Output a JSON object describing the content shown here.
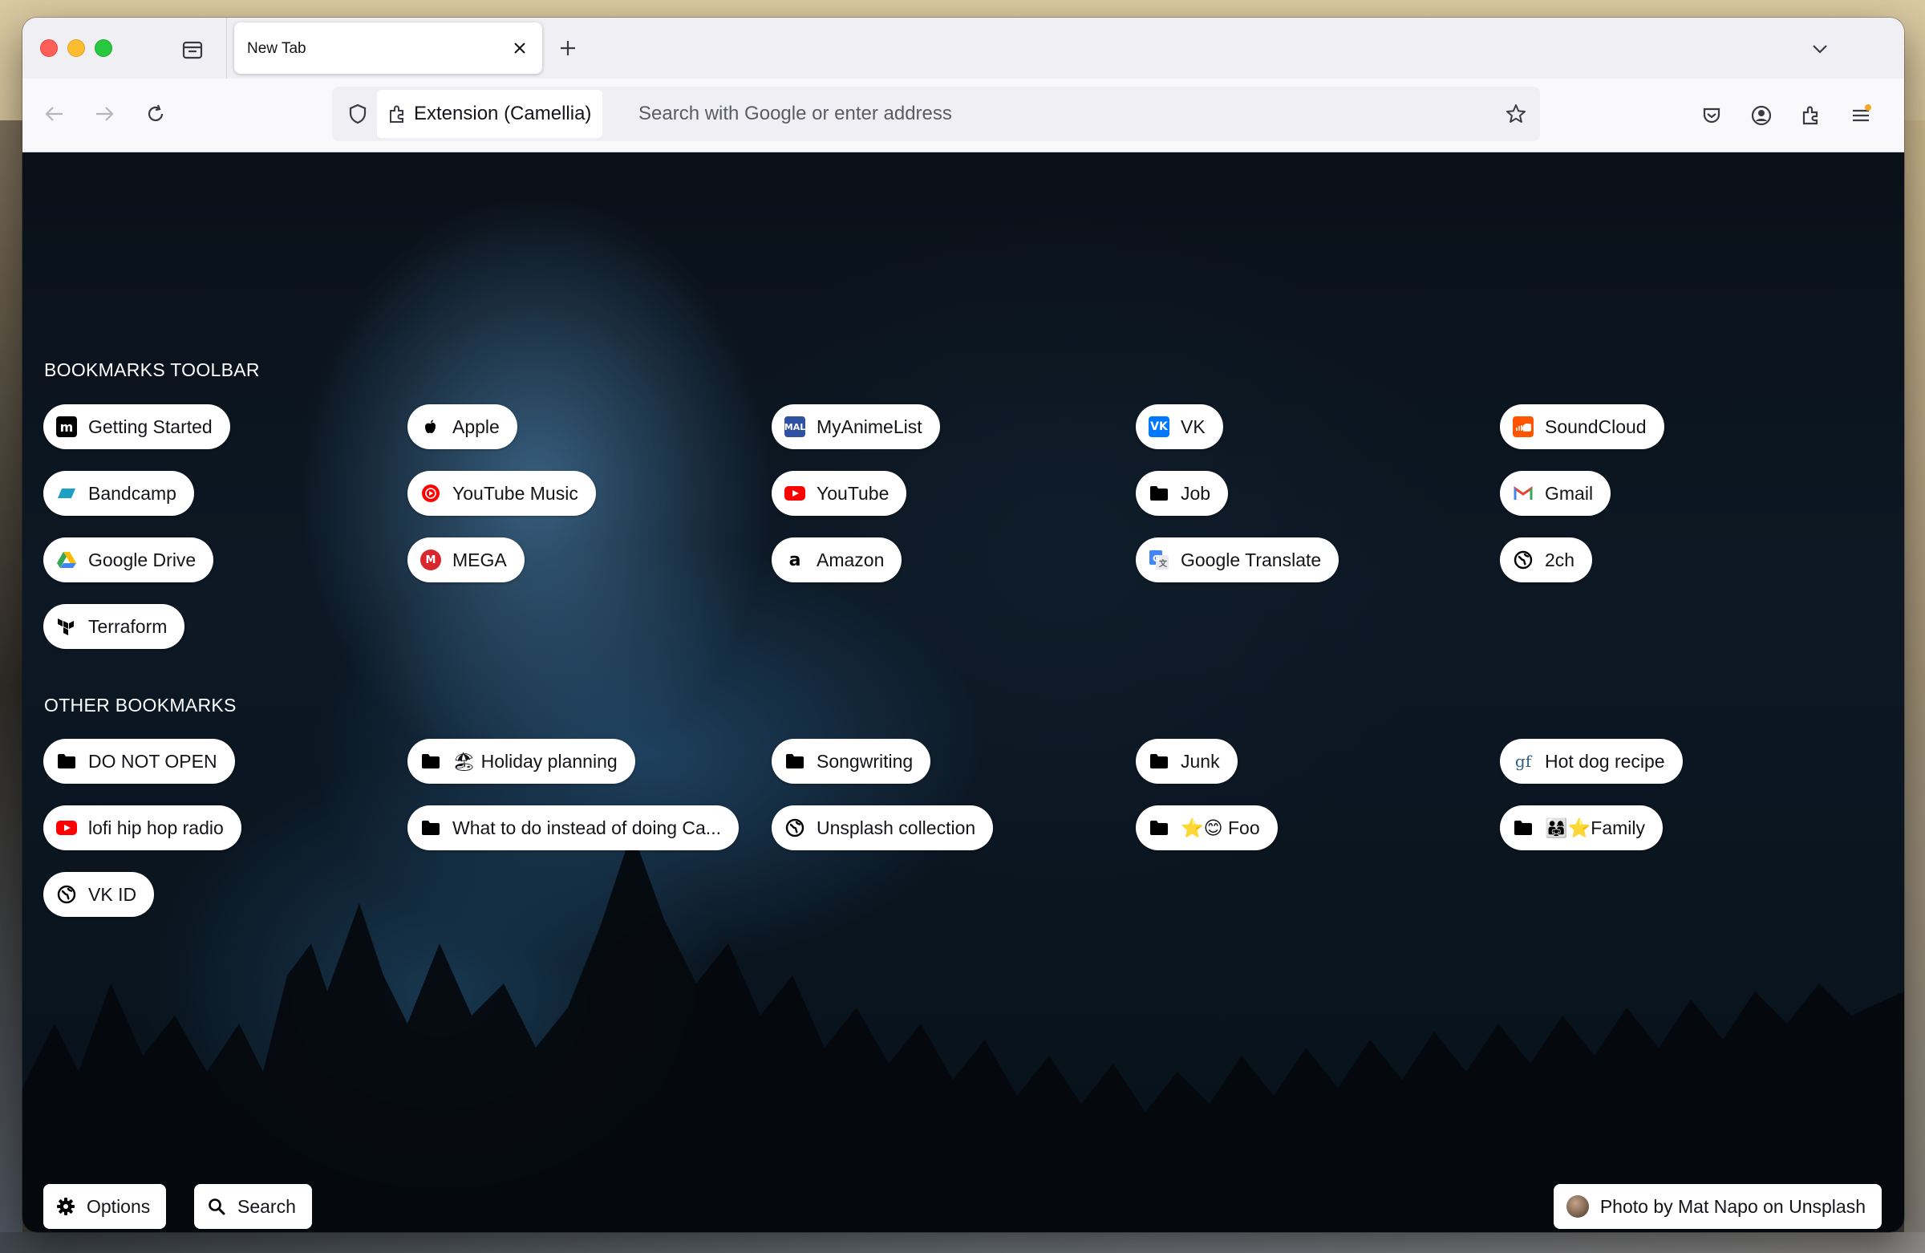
{
  "browser": {
    "tab_title": "New Tab",
    "extension_label": "Extension (Camellia)",
    "address_placeholder": "Search with Google or enter address"
  },
  "toolbar_section": {
    "title": "BOOKMARKS TOOLBAR",
    "items": [
      {
        "label": "Getting Started",
        "icon": "mozilla-icon"
      },
      {
        "label": "Apple",
        "icon": "apple-icon"
      },
      {
        "label": "MyAnimeList",
        "icon": "myanimelist-icon"
      },
      {
        "label": "VK",
        "icon": "vk-icon"
      },
      {
        "label": "SoundCloud",
        "icon": "soundcloud-icon"
      },
      {
        "label": "Bandcamp",
        "icon": "bandcamp-icon"
      },
      {
        "label": "YouTube Music",
        "icon": "youtube-music-icon"
      },
      {
        "label": "YouTube",
        "icon": "youtube-icon"
      },
      {
        "label": "Job",
        "icon": "folder-icon"
      },
      {
        "label": "Gmail",
        "icon": "gmail-icon"
      },
      {
        "label": "Google Drive",
        "icon": "google-drive-icon"
      },
      {
        "label": "MEGA",
        "icon": "mega-icon"
      },
      {
        "label": "Amazon",
        "icon": "amazon-icon"
      },
      {
        "label": "Google Translate",
        "icon": "google-translate-icon"
      },
      {
        "label": "2ch",
        "icon": "globe-icon"
      },
      {
        "label": "Terraform",
        "icon": "terraform-icon"
      }
    ]
  },
  "other_section": {
    "title": "OTHER BOOKMARKS",
    "items": [
      {
        "label": "DO NOT OPEN",
        "icon": "folder-icon"
      },
      {
        "label": "🏖 Holiday planning",
        "icon": "folder-icon"
      },
      {
        "label": "Songwriting",
        "icon": "folder-icon"
      },
      {
        "label": "Junk",
        "icon": "folder-icon"
      },
      {
        "label": "Hot dog recipe",
        "icon": "gf-icon"
      },
      {
        "label": "lofi hip hop radio",
        "icon": "youtube-icon"
      },
      {
        "label": "What to do instead of doing Ca...",
        "icon": "folder-icon"
      },
      {
        "label": "Unsplash collection",
        "icon": "globe-icon"
      },
      {
        "label": "⭐😊 Foo",
        "icon": "folder-icon"
      },
      {
        "label": "👨‍👩‍👧⭐Family",
        "icon": "folder-icon"
      },
      {
        "label": "VK ID",
        "icon": "globe-icon"
      }
    ]
  },
  "footer": {
    "options_label": "Options",
    "search_label": "Search",
    "credit_label": "Photo by Mat Napo on Unsplash"
  },
  "colors": {
    "youtube_red": "#ff0000",
    "vk_blue": "#0077ff",
    "soundcloud_orange": "#ff5500",
    "mega_red": "#d9272e"
  }
}
